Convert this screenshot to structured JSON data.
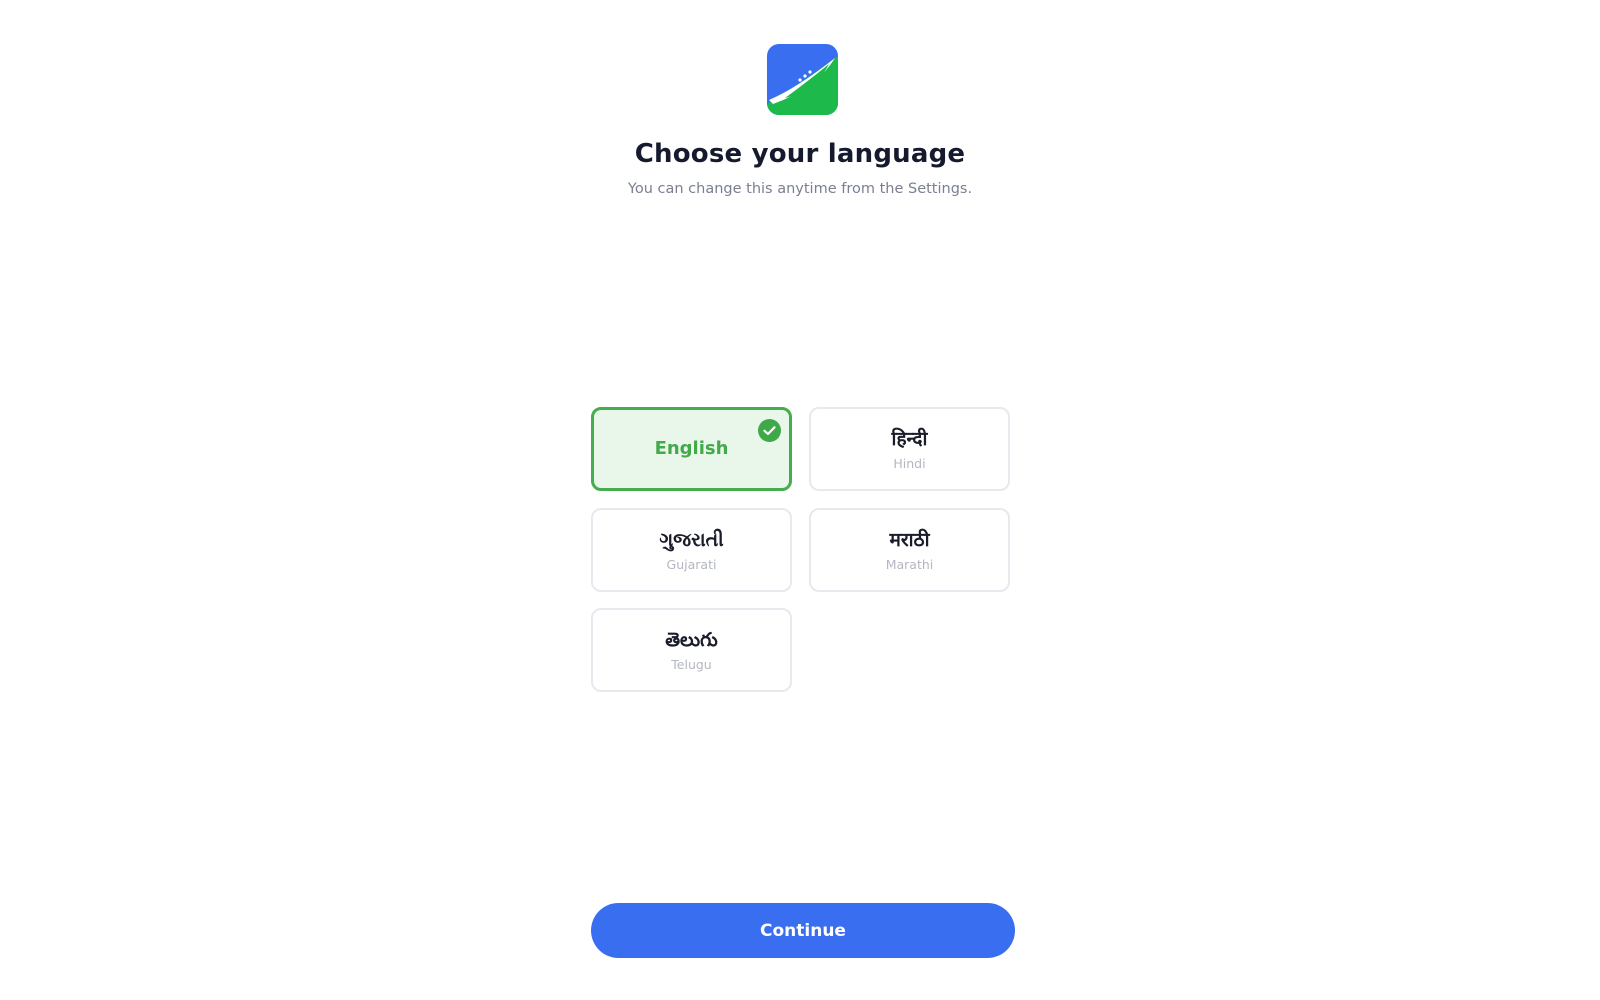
{
  "header": {
    "logo_icon": "leaf-logo-icon",
    "title": "Choose your language",
    "subtitle": "You can change this anytime from the Settings."
  },
  "languages": [
    {
      "native": "English",
      "latin": "",
      "selected": true
    },
    {
      "native": "हिन्दी",
      "latin": "Hindi",
      "selected": false
    },
    {
      "native": "ગુજરાતી",
      "latin": "Gujarati",
      "selected": false
    },
    {
      "native": "मराठी",
      "latin": "Marathi",
      "selected": false
    },
    {
      "native": "తెలుగు",
      "latin": "Telugu",
      "selected": false
    }
  ],
  "footer": {
    "continue_label": "Continue"
  },
  "colors": {
    "primary": "#3a6ef0",
    "selected_border": "#46ad4e",
    "selected_background": "#e9f6ea",
    "logo_blue": "#3a6ef0",
    "logo_green": "#1db94a"
  }
}
